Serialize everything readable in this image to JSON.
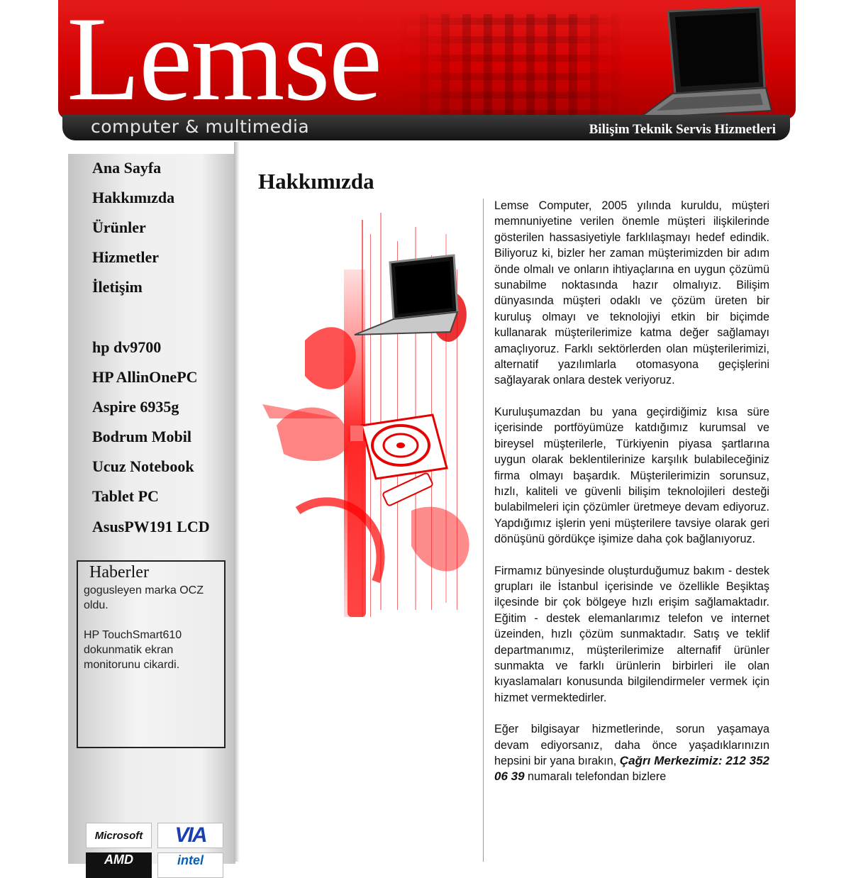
{
  "header": {
    "logo": "Lemse",
    "tagline": "computer & multimedia",
    "service": "Bilişim Teknik Servis Hizmetleri"
  },
  "nav": {
    "main": [
      {
        "label": "Ana Sayfa"
      },
      {
        "label": "Hakkımızda"
      },
      {
        "label": "Ürünler"
      },
      {
        "label": "Hizmetler"
      },
      {
        "label": "İletişim"
      }
    ],
    "products": [
      {
        "label": "hp dv9700"
      },
      {
        "label": "HP AllinOnePC"
      },
      {
        "label": "Aspire 6935g"
      },
      {
        "label": "Bodrum Mobil"
      },
      {
        "label": "Ucuz Notebook"
      },
      {
        "label": "Tablet PC"
      },
      {
        "label": "AsusPW191 LCD"
      }
    ]
  },
  "news": {
    "title": "Haberler",
    "items": [
      "gogusleyen marka OCZ oldu.",
      "HP TouchSmart610 dokunmatik ekran monitorunu cikardi."
    ]
  },
  "partners": {
    "microsoft": "Microsoft",
    "via": "VIA",
    "amd": "AMD",
    "intel": "intel"
  },
  "page": {
    "title": "Hakkımızda"
  },
  "content": {
    "p1": "Lemse Computer, 2005 yılında kuruldu, müşteri memnuniyetine verilen önemle müşteri ilişkilerinde gösterilen hassasiyetiyle farklılaşmayı hedef edindik. Biliyoruz ki, bizler her zaman müşterimizden bir adım önde olmalı ve onların ihtiyaçlarına en uygun çözümü sunabilme noktasında hazır olmalıyız. Bilişim dünyasında müşteri odaklı ve çözüm üreten bir kuruluş olmayı ve teknolojiyi etkin bir biçimde kullanarak müşterilerimize katma değer sağlamayı amaçlıyoruz. Farklı sektörlerden olan müşterilerimizi, alternatif yazılımlarla otomasyona geçişlerini sağlayarak onlara destek veriyoruz.",
    "p2": "Kuruluşumazdan bu yana geçirdiğimiz kısa süre içerisinde portföyümüze katdığımız kurumsal ve bireysel müşterilerle, Türkiyenin piyasa şartlarına uygun olarak beklentilerinize karşılık bulabileceğiniz firma olmayı başardık. Müşterilerimizin sorunsuz, hızlı, kaliteli ve güvenli bilişim teknolojileri desteği bulabilmeleri için çözümler üretmeye devam ediyoruz. Yapdığımız işlerin yeni müşterilere tavsiye olarak geri dönüşünü gördükçe işimize daha çok bağlanıyoruz.",
    "p3": "Firmamız bünyesinde oluşturduğumuz bakım - destek grupları ile İstanbul içerisinde ve özellikle Beşiktaş ilçesinde bir çok bölgeye hızlı erişim sağlamaktadır. Eğitim - destek elemanlarımız telefon ve internet üzeinden, hızlı çözüm sunmaktadır. Satış ve teklif departmanımız, müşterilerimize alternafif ürünler sunmakta ve farklı ürünlerin birbirleri ile olan kıyaslamaları konusunda bilgilendirmeler vermek için hizmet vermektedirler.",
    "p4_before": "Eğer bilgisayar hizmetlerinde, sorun yaşamaya devam ediyorsanız, daha önce yaşadıklarınızın hepsini bir yana bırakın, ",
    "p4_bold": "Çağrı Merkezimiz: 212 352 06 39",
    "p4_after": " numaralı telefondan bizlere"
  },
  "colors": {
    "brand_red": "#d40000",
    "dark_bar": "#1e1e1e",
    "sidebar_gray": "#e6e6e6"
  },
  "icons": {
    "header_laptop": "laptop-icon",
    "art_laptop": "laptop-icon",
    "art_turntable": "turntable-icon",
    "art_usb": "usb-stick-icon"
  }
}
